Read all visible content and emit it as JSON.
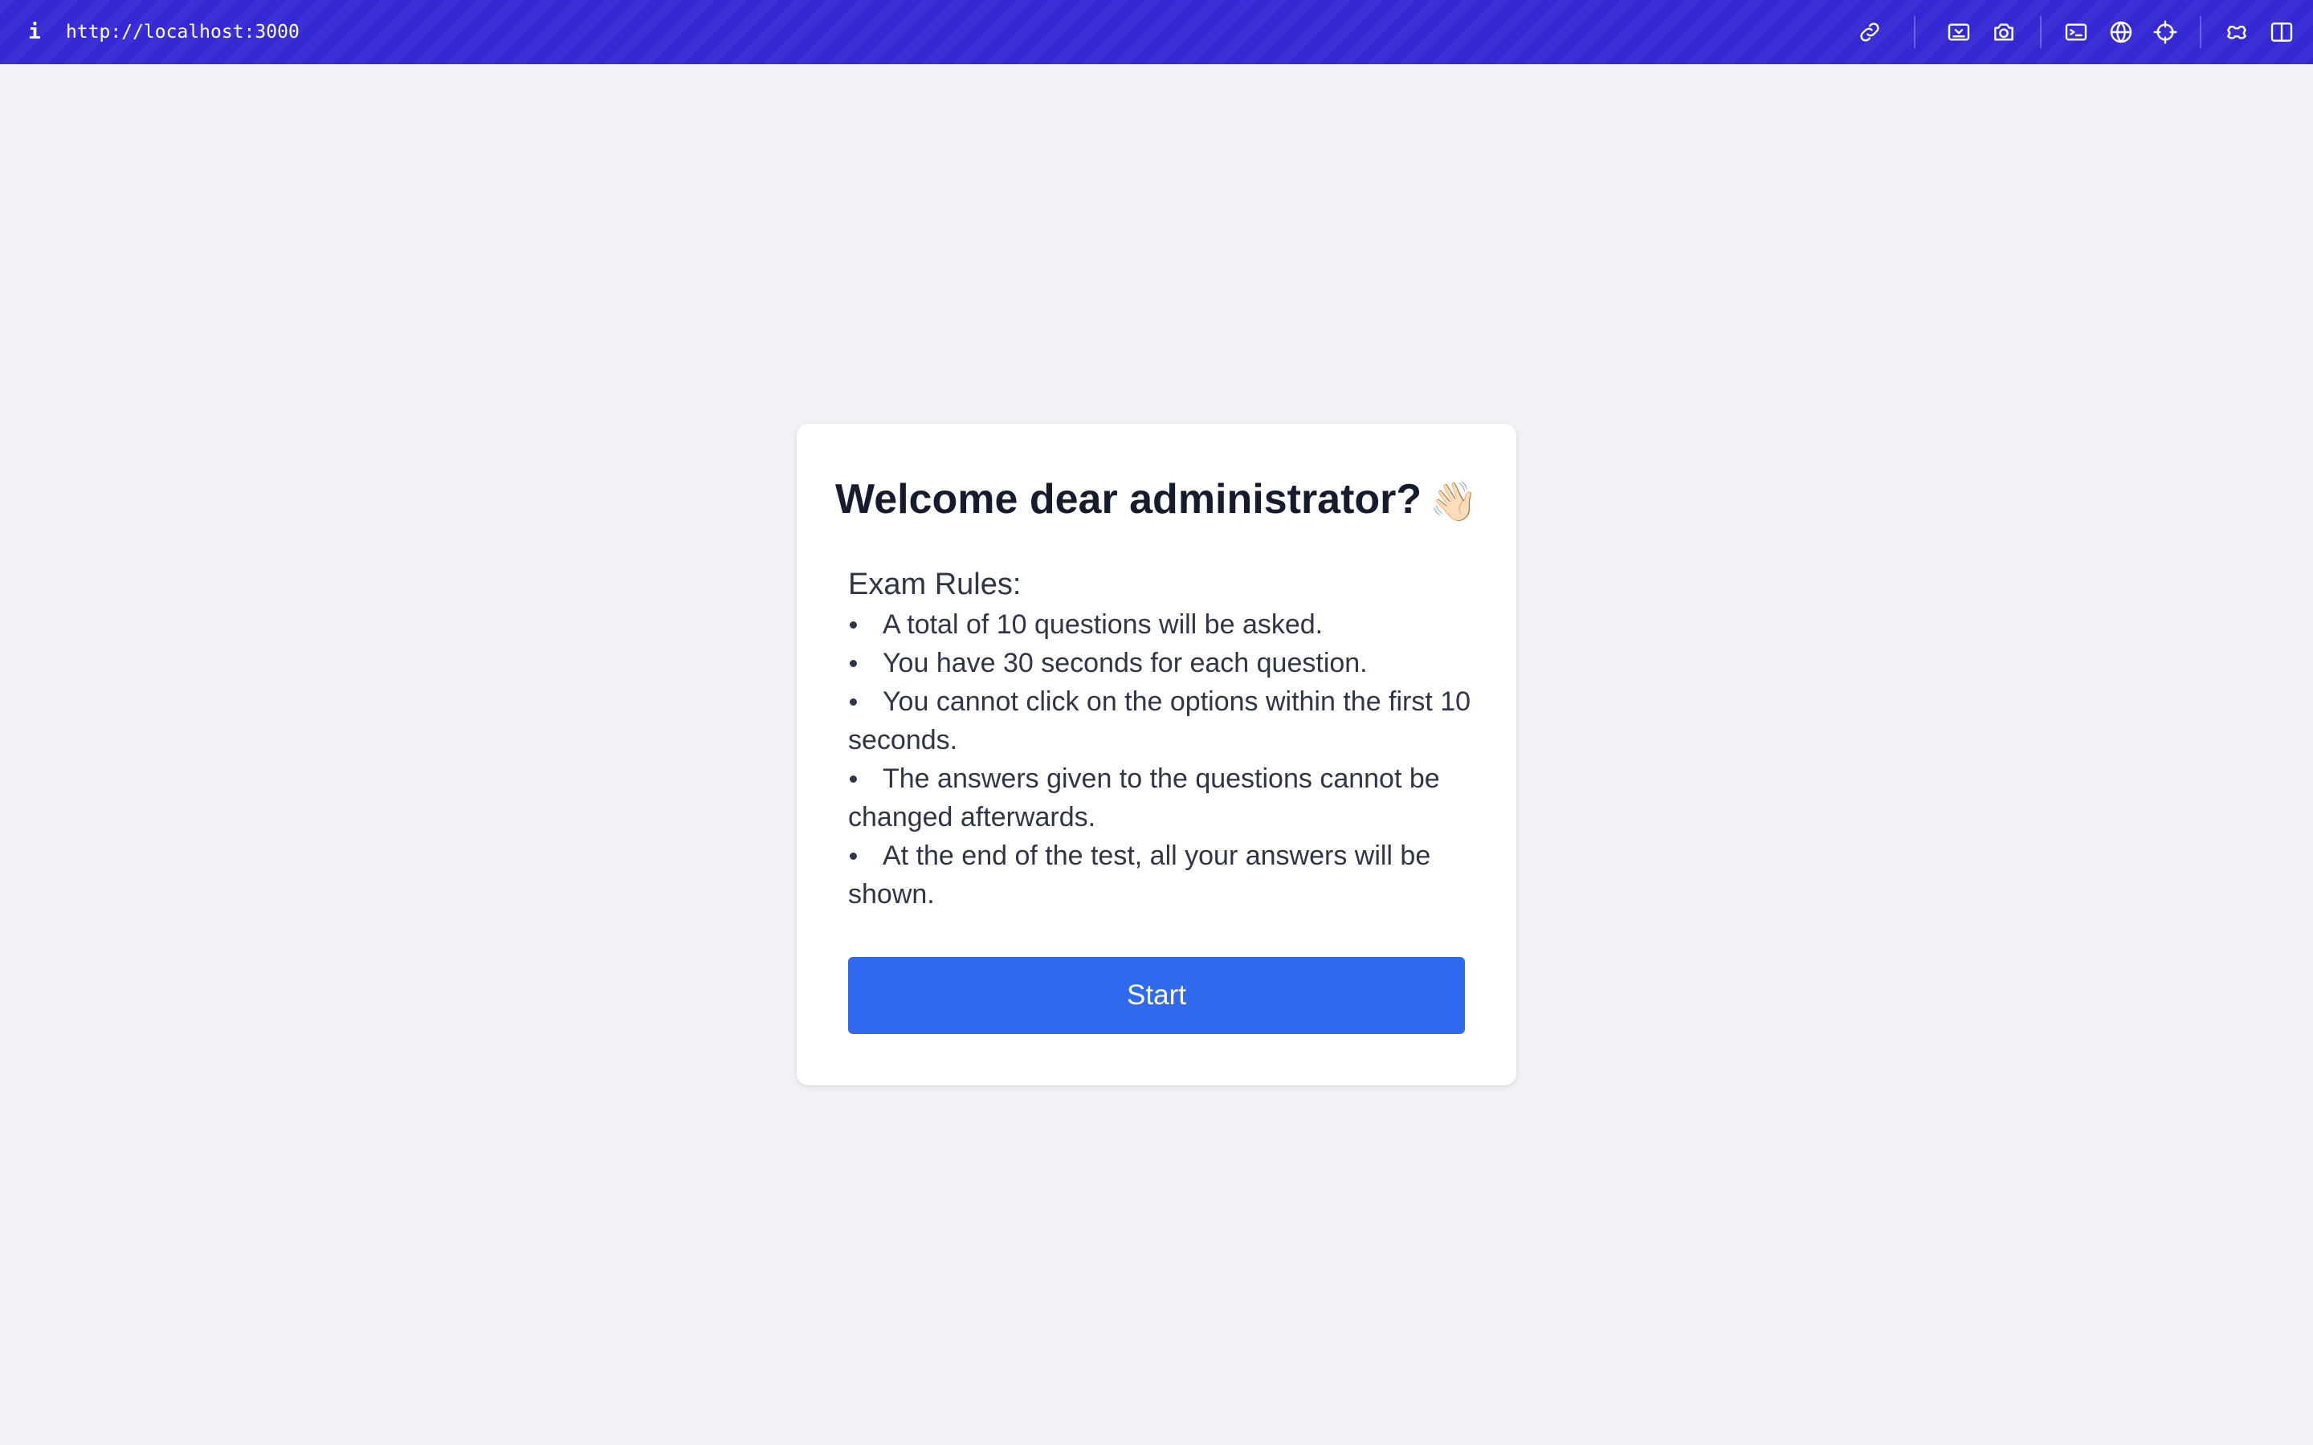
{
  "browser": {
    "info_label": "i",
    "url": "http://localhost:3000",
    "toolbar_icons": [
      "link-icon",
      "responsive-icon",
      "camera-icon",
      "terminal-icon",
      "globe-icon",
      "crosshair-icon",
      "extension-icon",
      "split-view-icon"
    ],
    "accent_color": "#3428d4"
  },
  "card": {
    "title": "Welcome dear administrator?",
    "title_emoji": "👋🏻",
    "rules_heading": "Exam Rules:",
    "rules": [
      "A total of 10 questions will be asked.",
      "You have 30 seconds for each question.",
      "You cannot click on the options within the first 10 seconds.",
      "The answers given to the questions cannot be changed afterwards.",
      "At the end of the test, all your answers will be shown."
    ],
    "start_label": "Start",
    "button_color": "#2f69ee"
  }
}
